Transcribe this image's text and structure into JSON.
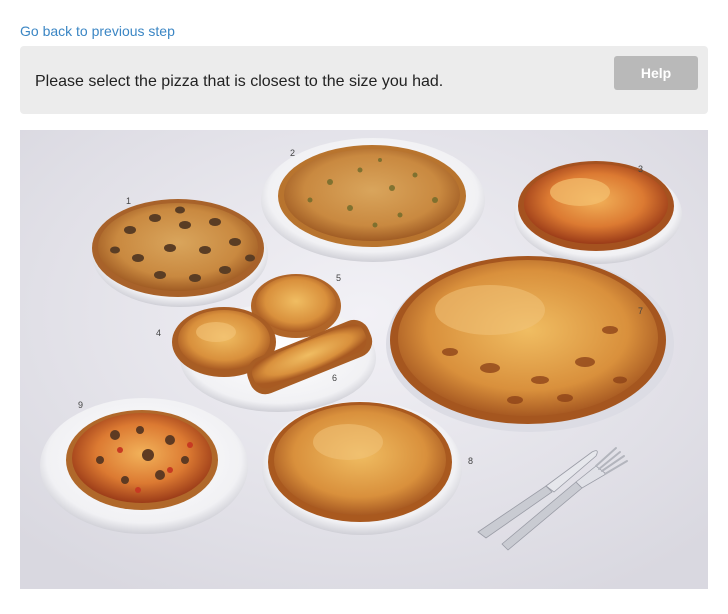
{
  "navigation": {
    "back_label": "Go back to previous step"
  },
  "prompt": {
    "text": "Please select the pizza that is closest to the size you had.",
    "help_label": "Help"
  },
  "pizza_image": {
    "options": [
      {
        "number": "1",
        "topping": "mushroom"
      },
      {
        "number": "2",
        "topping": "herb"
      },
      {
        "number": "3",
        "topping": "tomato-cheese"
      },
      {
        "number": "4",
        "topping": "cheese-slice"
      },
      {
        "number": "5",
        "topping": "cheese-slice"
      },
      {
        "number": "6",
        "topping": "french-bread"
      },
      {
        "number": "7",
        "topping": "large-margherita"
      },
      {
        "number": "8",
        "topping": "margherita"
      },
      {
        "number": "9",
        "topping": "vegetable"
      }
    ],
    "cutlery": [
      "knife",
      "fork"
    ]
  },
  "colors": {
    "link": "#3b86c4",
    "panel_background": "#ececec",
    "help_button": "#b9b9b9",
    "photo_background": "#e9e8ee",
    "plate": "#f7f7f9",
    "crust": "#c98a3a",
    "cheese": "#e2a14a",
    "browned": "#b5652a"
  }
}
